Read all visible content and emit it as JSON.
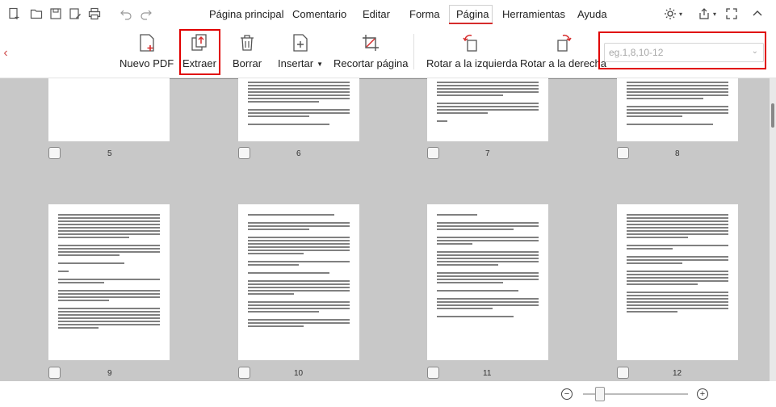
{
  "menu": {
    "items": [
      {
        "label": "Página principal"
      },
      {
        "label": "Comentario"
      },
      {
        "label": "Editar"
      },
      {
        "label": "Forma"
      },
      {
        "label": "Página",
        "active": true
      },
      {
        "label": "Herramientas"
      },
      {
        "label": "Ayuda"
      }
    ]
  },
  "toolbar_icons": [
    "new-file-icon",
    "open-folder-icon",
    "save-icon",
    "edit-save-icon",
    "print-icon",
    "undo-icon",
    "redo-icon"
  ],
  "right_icons": [
    "theme-icon",
    "share-icon",
    "fullscreen-icon",
    "collapse-ribbon-icon"
  ],
  "ribbon": {
    "nuevo_pdf": "Nuevo PDF",
    "extraer": "Extraer",
    "borrar": "Borrar",
    "insertar": "Insertar",
    "recortar": "Recortar página",
    "rotar_izq": "Rotar a la izquierda",
    "rotar_der": "Rotar a la derecha",
    "page_range_placeholder": "eg.1,8,10-12"
  },
  "colors": {
    "accent": "#d62c2c",
    "highlight_box": "#e00000",
    "grid_bg": "#c8c8c8"
  },
  "pages": {
    "row1": [
      "5",
      "6",
      "7",
      "8"
    ],
    "row2": [
      "9",
      "10",
      "11",
      "12"
    ]
  },
  "zoom": {
    "minus": "−",
    "plus": "+",
    "level": 0.12
  }
}
